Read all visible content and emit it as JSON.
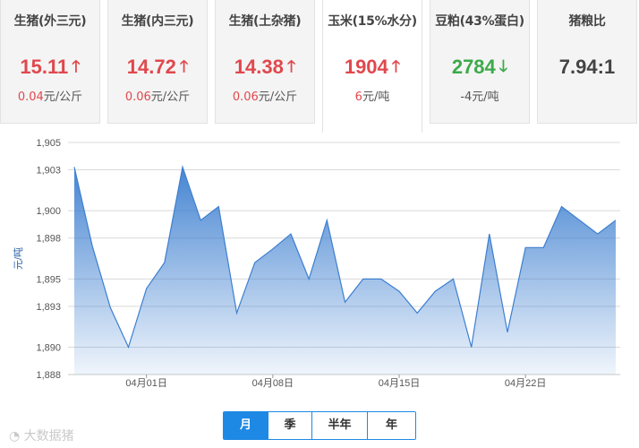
{
  "cards": [
    {
      "title": "生猪(外三元)",
      "price": "15.11",
      "direction": "up",
      "arrow": "🡑",
      "change_num": "0.04",
      "change_unit": "元/公斤"
    },
    {
      "title": "生猪(内三元)",
      "price": "14.72",
      "direction": "up",
      "arrow": "🡑",
      "change_num": "0.06",
      "change_unit": "元/公斤"
    },
    {
      "title": "生猪(土杂猪)",
      "price": "14.38",
      "direction": "up",
      "arrow": "🡑",
      "change_num": "0.06",
      "change_unit": "元/公斤"
    },
    {
      "title": "玉米(15%水分)",
      "price": "1904",
      "direction": "up",
      "arrow": "🡑",
      "change_num": "6",
      "change_unit": "元/吨"
    },
    {
      "title": "豆粕(43%蛋白)",
      "price": "2784",
      "direction": "down",
      "arrow": "🡓",
      "change_num": "-4",
      "change_unit": "元/吨"
    },
    {
      "title": "猪粮比",
      "price": "7.94:1",
      "direction": "neutral",
      "arrow": "",
      "change_num": "",
      "change_unit": ""
    }
  ],
  "colors": {
    "up": "#e0484d",
    "down": "#3caa4a",
    "accent": "#1e88e5",
    "line": "#3d7fd0"
  },
  "chart_data": {
    "type": "area",
    "ylabel": "元/吨",
    "xlabel": "",
    "ylim": [
      1888,
      1905
    ],
    "yticks": [
      1888,
      1890,
      1893,
      1895,
      1898,
      1900,
      1903,
      1905
    ],
    "ytick_labels": [
      "1,888",
      "1,890",
      "1,893",
      "1,895",
      "1,898",
      "1,900",
      "1,903",
      "1,905"
    ],
    "x_tick_labels": [
      "04月01日",
      "04月08日",
      "04月15日",
      "04月22日"
    ],
    "x_tick_indices": [
      4,
      11,
      18,
      25
    ],
    "x_start_day": 28,
    "values": [
      1903.2,
      1897.4,
      1892.9,
      1890.0,
      1894.3,
      1896.2,
      1903.2,
      1899.3,
      1900.3,
      1892.5,
      1896.2,
      1897.2,
      1898.3,
      1895.0,
      1899.3,
      1893.3,
      1895.0,
      1895.0,
      1894.1,
      1892.5,
      1894.1,
      1895.0,
      1890.0,
      1898.3,
      1891.1,
      1897.3,
      1897.3,
      1900.3,
      1899.3,
      1898.3,
      1899.3
    ],
    "grid": true
  },
  "tabs": [
    "月",
    "季",
    "半年",
    "年"
  ],
  "active_tab": 0,
  "watermark": "大数据猪"
}
